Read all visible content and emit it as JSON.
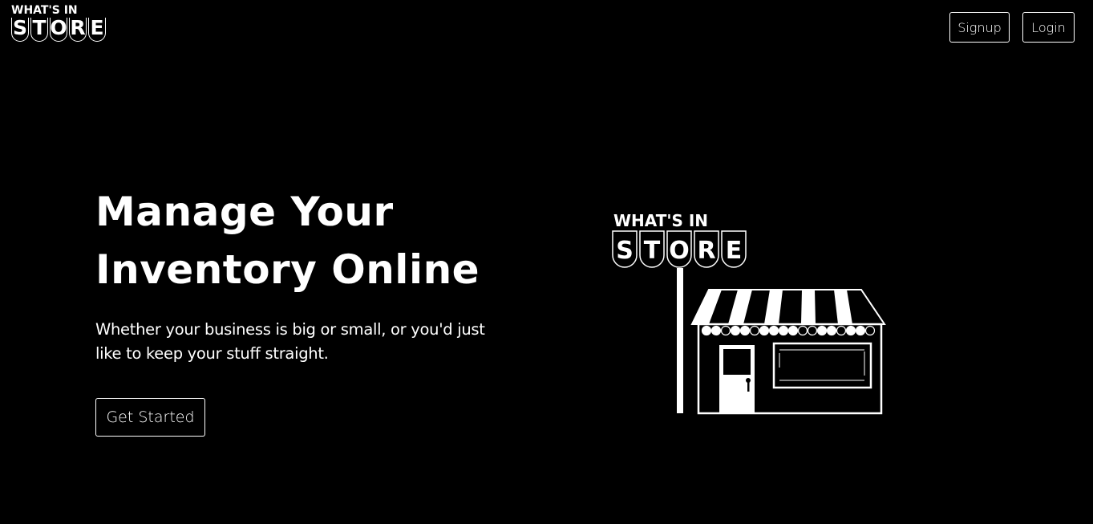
{
  "header": {
    "logo": {
      "top_text": "WHAT'S IN",
      "letters": [
        "S",
        "T",
        "O",
        "R",
        "E"
      ]
    },
    "nav": {
      "signup_label": "Signup",
      "login_label": "Login"
    }
  },
  "hero": {
    "title_line1": "Manage Your",
    "title_line2": "Inventory Online",
    "subtitle": "Whether your business is big or small, or you'd just like to keep your stuff straight.",
    "cta_label": "Get Started"
  },
  "illustration": {
    "sign_top_text": "WHAT'S IN",
    "sign_letters": [
      "S",
      "T",
      "O",
      "R",
      "E"
    ],
    "icon": "storefront-illustration"
  },
  "colors": {
    "background": "#000000",
    "foreground": "#ffffff"
  }
}
